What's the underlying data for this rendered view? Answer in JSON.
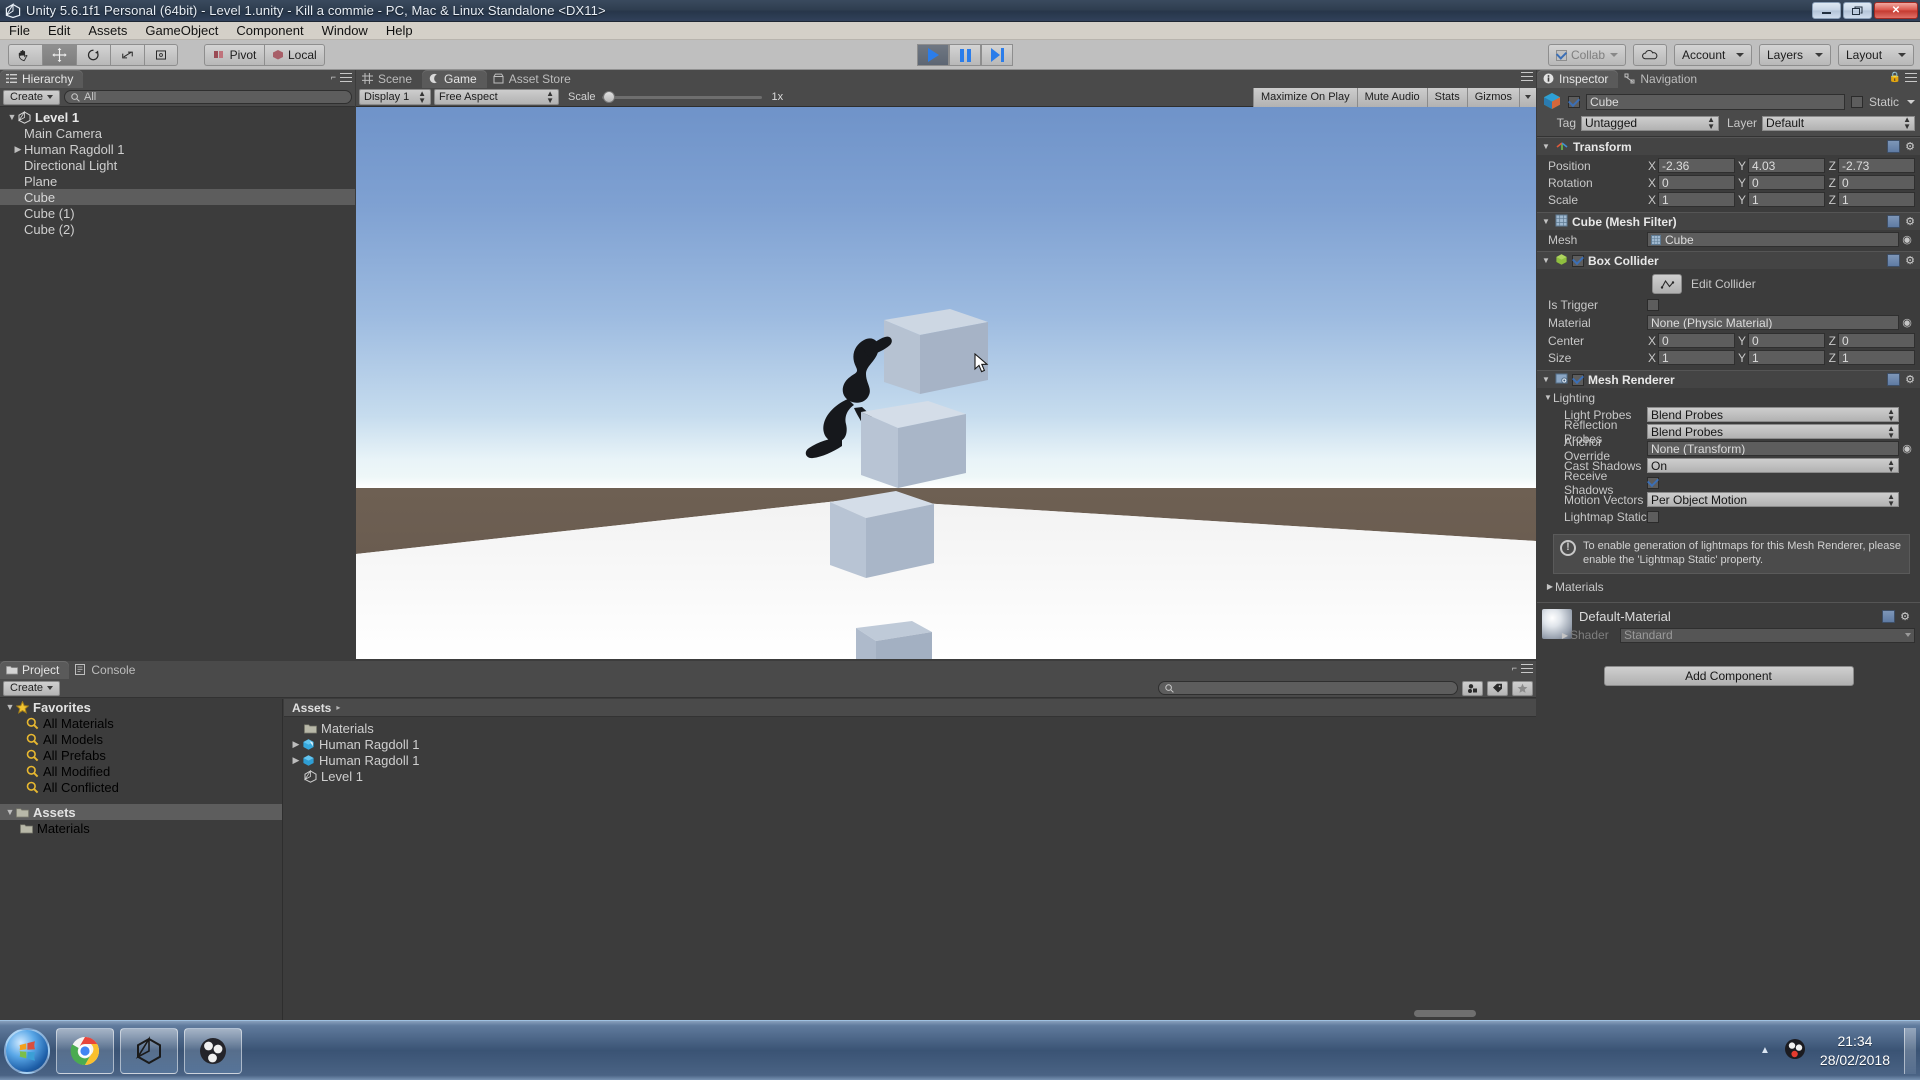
{
  "window": {
    "title": "Unity 5.6.1f1 Personal (64bit) - Level 1.unity - Kill a commie - PC, Mac & Linux Standalone <DX11>",
    "minimize_label": "—",
    "maximize_label": "❐",
    "close_label": "✕"
  },
  "menubar": {
    "items": [
      "File",
      "Edit",
      "Assets",
      "GameObject",
      "Component",
      "Window",
      "Help"
    ]
  },
  "toolbar": {
    "transform_tools": [
      {
        "name": "hand-tool",
        "glyph": "✋",
        "active": false
      },
      {
        "name": "move-tool",
        "glyph": "✥",
        "active": true
      },
      {
        "name": "rotate-tool",
        "glyph": "⟳",
        "active": false
      },
      {
        "name": "scale-tool",
        "glyph": "⤡",
        "active": false
      },
      {
        "name": "rect-tool",
        "glyph": "❏",
        "active": false
      }
    ],
    "pivot_label": "Pivot",
    "local_label": "Local",
    "play_label": "Play",
    "pause_label": "Pause",
    "step_label": "Step",
    "collab_label": "Collab",
    "cloud_label": "Cloud",
    "account_label": "Account",
    "layers_label": "Layers",
    "layout_label": "Layout"
  },
  "hierarchy": {
    "tab_label": "Hierarchy",
    "create_label": "Create",
    "search_placeholder": "All",
    "search_value": "",
    "items": [
      {
        "label": "Level 1",
        "depth": 0,
        "arrow": "▼",
        "icon": "unity-scene-icon",
        "selected": false,
        "root": true
      },
      {
        "label": "Main Camera",
        "depth": 1,
        "arrow": "",
        "icon": "",
        "selected": false,
        "root": false
      },
      {
        "label": "Human Ragdoll 1",
        "depth": 1,
        "arrow": "▶",
        "icon": "",
        "selected": false,
        "root": false
      },
      {
        "label": "Directional Light",
        "depth": 1,
        "arrow": "",
        "icon": "",
        "selected": false,
        "root": false
      },
      {
        "label": "Plane",
        "depth": 1,
        "arrow": "",
        "icon": "",
        "selected": false,
        "root": false
      },
      {
        "label": "Cube",
        "depth": 1,
        "arrow": "",
        "icon": "",
        "selected": true,
        "root": false
      },
      {
        "label": "Cube (1)",
        "depth": 1,
        "arrow": "",
        "icon": "",
        "selected": false,
        "root": false
      },
      {
        "label": "Cube (2)",
        "depth": 1,
        "arrow": "",
        "icon": "",
        "selected": false,
        "root": false
      }
    ]
  },
  "center_view": {
    "tabs": [
      {
        "label": "Scene",
        "icon": "grid-icon",
        "active": false
      },
      {
        "label": "Game",
        "icon": "gamepad-icon",
        "active": true
      },
      {
        "label": "Asset Store",
        "icon": "store-icon",
        "active": false
      }
    ],
    "display_label": "Display 1",
    "aspect_label": "Free Aspect",
    "scale_label": "Scale",
    "scale_value": "1x",
    "scale_slider_pct": 2,
    "maximize_on_play_label": "Maximize On Play",
    "mute_audio_label": "Mute Audio",
    "stats_label": "Stats",
    "gizmos_label": "Gizmos"
  },
  "project": {
    "tabs": [
      {
        "label": "Project",
        "icon": "folder-icon",
        "active": true
      },
      {
        "label": "Console",
        "icon": "console-icon",
        "active": false
      }
    ],
    "create_label": "Create",
    "search_placeholder": "",
    "search_value": "",
    "favorites_label": "Favorites",
    "favorites": [
      {
        "label": "All Materials",
        "icon": "search-icon"
      },
      {
        "label": "All Models",
        "icon": "search-icon"
      },
      {
        "label": "All Prefabs",
        "icon": "search-icon"
      },
      {
        "label": "All Modified",
        "icon": "search-icon"
      },
      {
        "label": "All Conflicted",
        "icon": "search-icon"
      }
    ],
    "assets_label": "Assets",
    "assets_tree": [
      {
        "label": "Materials",
        "icon": "folder-icon"
      }
    ],
    "breadcrumb": "Assets",
    "breadcrumb_arrow": "▸",
    "files": [
      {
        "label": "Materials",
        "icon": "folder-icon",
        "arrow": ""
      },
      {
        "label": "Human Ragdoll 1",
        "icon": "prefab-icon",
        "arrow": "▶"
      },
      {
        "label": "Human Ragdoll 1",
        "icon": "prefab-blue-icon",
        "arrow": "▶"
      },
      {
        "label": "Level 1",
        "icon": "unity-scene-icon",
        "arrow": ""
      }
    ]
  },
  "inspector": {
    "tabs": [
      {
        "label": "Inspector",
        "icon": "info-icon",
        "active": true
      },
      {
        "label": "Navigation",
        "icon": "navigation-icon",
        "active": false
      }
    ],
    "object_name": "Cube",
    "object_enabled": true,
    "static_label": "Static",
    "static_checked": false,
    "tag_label": "Tag",
    "tag_value": "Untagged",
    "layer_label": "Layer",
    "layer_value": "Default",
    "transform": {
      "title": "Transform",
      "position_label": "Position",
      "position": {
        "x": "-2.36",
        "y": "4.03",
        "z": "-2.73"
      },
      "rotation_label": "Rotation",
      "rotation": {
        "x": "0",
        "y": "0",
        "z": "0"
      },
      "scale_label": "Scale",
      "scale": {
        "x": "1",
        "y": "1",
        "z": "1"
      }
    },
    "mesh_filter": {
      "title": "Cube (Mesh Filter)",
      "mesh_label": "Mesh",
      "mesh_value": "Cube"
    },
    "box_collider": {
      "title": "Box Collider",
      "enabled": true,
      "edit_collider_label": "Edit Collider",
      "is_trigger_label": "Is Trigger",
      "is_trigger_checked": false,
      "material_label": "Material",
      "material_value": "None (Physic Material)",
      "center_label": "Center",
      "center": {
        "x": "0",
        "y": "0",
        "z": "0"
      },
      "size_label": "Size",
      "size": {
        "x": "1",
        "y": "1",
        "z": "1"
      }
    },
    "mesh_renderer": {
      "title": "Mesh Renderer",
      "enabled": true,
      "lighting_label": "Lighting",
      "light_probes_label": "Light Probes",
      "light_probes_value": "Blend Probes",
      "reflection_probes_label": "Reflection Probes",
      "reflection_probes_value": "Blend Probes",
      "anchor_override_label": "Anchor Override",
      "anchor_override_value": "None (Transform)",
      "cast_shadows_label": "Cast Shadows",
      "cast_shadows_value": "On",
      "receive_shadows_label": "Receive Shadows",
      "receive_shadows_checked": true,
      "motion_vectors_label": "Motion Vectors",
      "motion_vectors_value": "Per Object Motion",
      "lightmap_static_label": "Lightmap Static",
      "lightmap_static_checked": false,
      "info_text": "To enable generation of lightmaps for this Mesh Renderer, please enable the 'Lightmap Static' property.",
      "materials_label": "Materials"
    },
    "material": {
      "name": "Default-Material",
      "shader_label": "Shader",
      "shader_value": "Standard"
    },
    "add_component_label": "Add Component"
  },
  "taskbar": {
    "start_label": "Start",
    "buttons": [
      {
        "name": "chrome",
        "label": "Google Chrome"
      },
      {
        "name": "unity",
        "label": "Unity"
      },
      {
        "name": "obs",
        "label": "OBS Studio"
      }
    ],
    "tray_expand": "▲",
    "tray_icon": "obs-tray-icon",
    "time": "21:34",
    "date": "28/02/2018"
  }
}
